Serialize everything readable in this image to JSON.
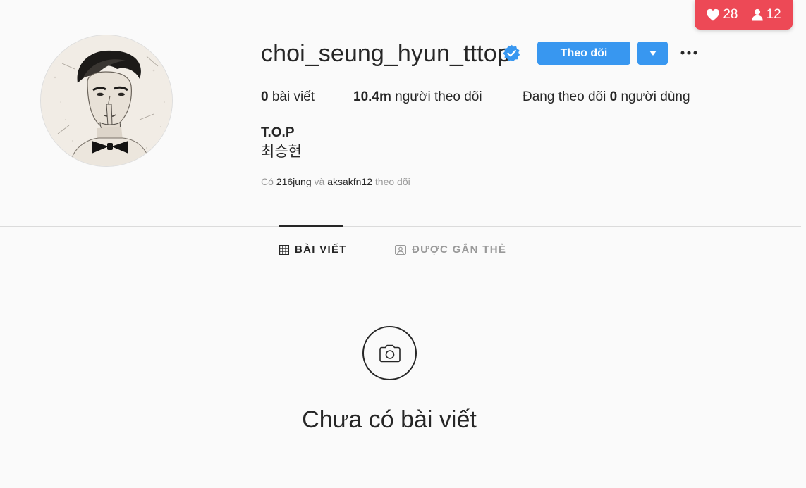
{
  "notification": {
    "likes_count": "28",
    "followers_count": "12"
  },
  "profile": {
    "username": "choi_seung_hyun_tttop",
    "verified": true,
    "follow_label": "Theo dõi",
    "posts_count": "0",
    "posts_label": "bài viết",
    "followers_count": "10.4m",
    "followers_label": "người theo dõi",
    "following_prefix": "Đang theo dõi",
    "following_count": "0",
    "following_label": "người dùng",
    "full_name": "T.O.P",
    "bio": "최승현",
    "followed_by_prefix": "Có",
    "followed_by_user1": "216jung",
    "followed_by_and": "và",
    "followed_by_user2": "aksakfn12",
    "followed_by_suffix": "theo dõi"
  },
  "tabs": {
    "posts_label": "BÀI VIẾT",
    "tagged_label": "ĐƯỢC GẮN THẺ"
  },
  "empty_state": {
    "message": "Chưa có bài viết"
  },
  "colors": {
    "accent": "#3897f0",
    "notification": "#ed4956",
    "text": "#262626",
    "muted": "#999999",
    "background": "#fafafa"
  }
}
